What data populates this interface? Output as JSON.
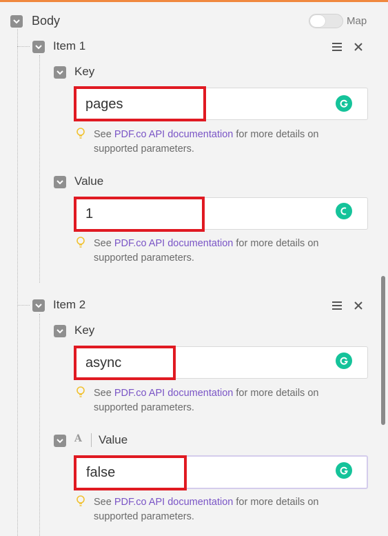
{
  "body": {
    "label": "Body",
    "map_label": "Map",
    "map_enabled": false
  },
  "items": [
    {
      "label": "Item 1",
      "key": {
        "label": "Key",
        "value": "pages"
      },
      "value": {
        "label": "Value",
        "value": "1"
      }
    },
    {
      "label": "Item 2",
      "key": {
        "label": "Key",
        "value": "async"
      },
      "value": {
        "label": "Value",
        "value": "false"
      }
    }
  ],
  "hint": {
    "prefix": "See ",
    "link": "PDF.co API documentation",
    "suffix": " for more details on supported parameters."
  },
  "colors": {
    "accent": "#f0883e",
    "link": "#7a55c6",
    "grammarly": "#15c39a",
    "highlight": "#e01a22"
  }
}
